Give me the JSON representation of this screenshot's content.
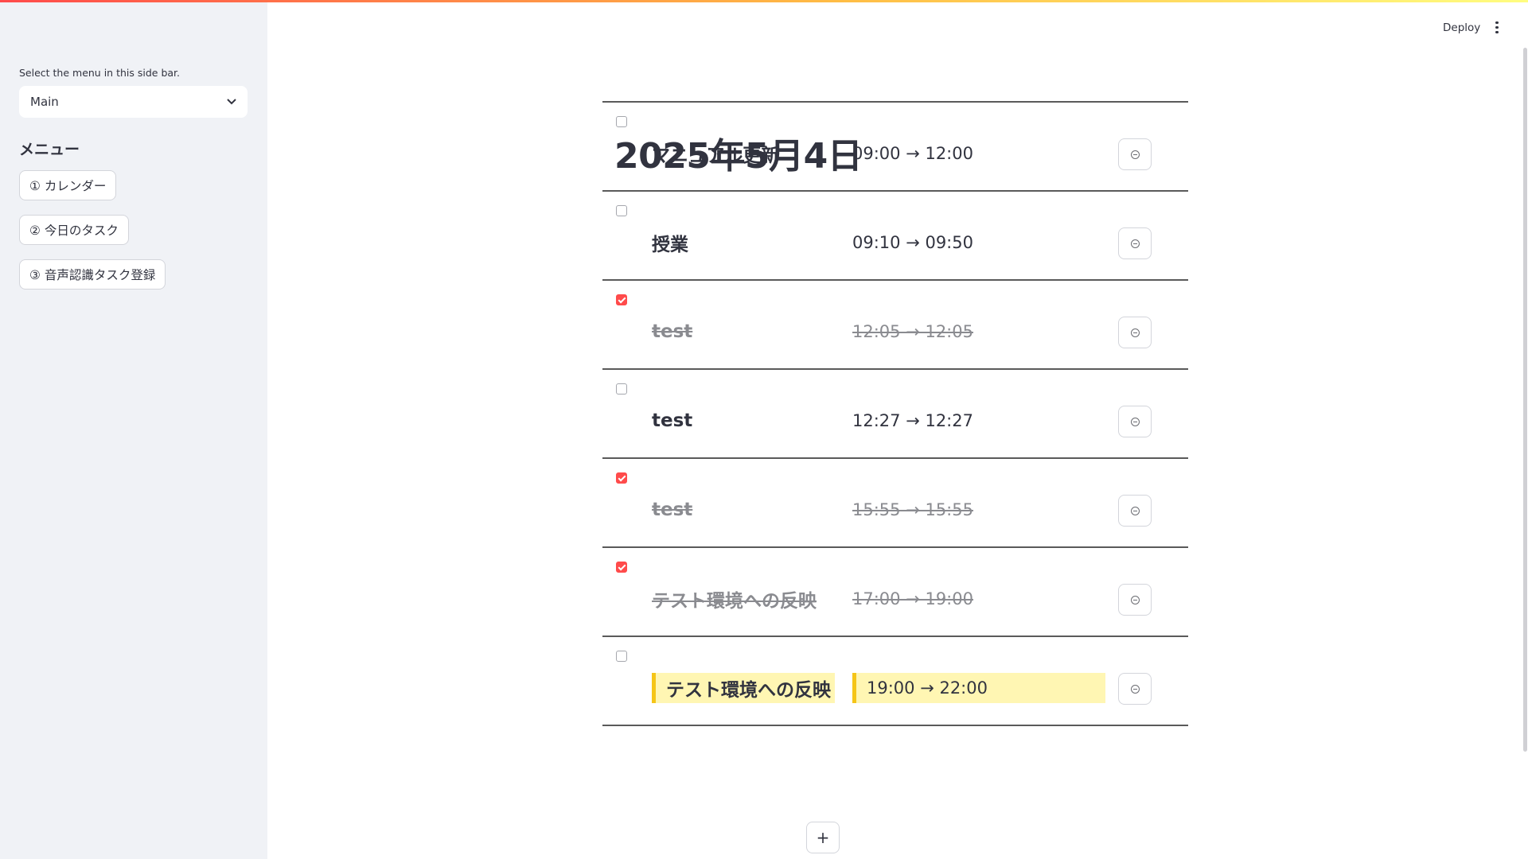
{
  "header": {
    "deploy_label": "Deploy",
    "more_icon": "vertical-dots-icon"
  },
  "sidebar": {
    "select_label": "Select the menu in this side bar.",
    "select_value": "Main",
    "menu_heading": "メニュー",
    "buttons": [
      "① カレンダー",
      "② 今日のタスク",
      "③ 音声認識タスク登録"
    ]
  },
  "main": {
    "date_title": "2025年5月4日",
    "tasks": [
      {
        "title": "マニュアル更新",
        "time": "09:00 → 12:00",
        "done": false,
        "highlight": false
      },
      {
        "title": "授業",
        "time": "09:10 → 09:50",
        "done": false,
        "highlight": false
      },
      {
        "title": "test",
        "time": "12:05 → 12:05",
        "done": true,
        "highlight": false
      },
      {
        "title": "test",
        "time": "12:27 → 12:27",
        "done": false,
        "highlight": false
      },
      {
        "title": "test",
        "time": "15:55 → 15:55",
        "done": true,
        "highlight": false
      },
      {
        "title": "テスト環境への反映",
        "time": "17:00 → 19:00",
        "done": true,
        "highlight": false
      },
      {
        "title": "テスト環境への反映",
        "time": "19:00 → 22:00",
        "done": false,
        "highlight": true
      }
    ],
    "row_button_icon": "minus-circle-icon",
    "add_button_label": "+"
  },
  "colors": {
    "accent": "#ff4b4b",
    "highlight_bg": "#fff6b3",
    "highlight_border": "#f5c518",
    "sidebar_bg": "#f0f2f6"
  }
}
